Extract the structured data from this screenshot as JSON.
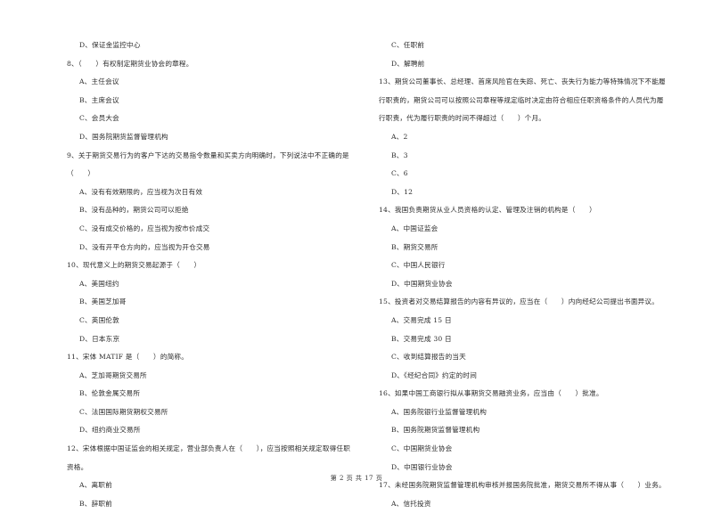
{
  "left_column": [
    {
      "type": "opt",
      "text": "D、保证金监控中心"
    },
    {
      "type": "q",
      "text": "8、（　　）有权制定期货业协会的章程。"
    },
    {
      "type": "opt",
      "text": "A、主任会议"
    },
    {
      "type": "opt",
      "text": "B、主席会议"
    },
    {
      "type": "opt",
      "text": "C、会员大会"
    },
    {
      "type": "opt",
      "text": "D、国务院期货监督管理机构"
    },
    {
      "type": "q",
      "text": "9、关于期货交易行为的客户下达的交易指令数量和买卖方向明确时，下列说法中不正确的是"
    },
    {
      "type": "q",
      "text": "（　　）"
    },
    {
      "type": "opt",
      "text": "A、没有有效期限的，应当视为次日有效"
    },
    {
      "type": "opt",
      "text": "B、没有品种的，期货公司可以拒绝"
    },
    {
      "type": "opt",
      "text": "C、没有成交价格的，应当视为按市价成交"
    },
    {
      "type": "opt",
      "text": "D、没有开平仓方向的，应当视为开仓交易"
    },
    {
      "type": "q",
      "text": "10、现代意义上的期货交易起源于（　　）"
    },
    {
      "type": "opt",
      "text": "A、美国纽约"
    },
    {
      "type": "opt",
      "text": "B、美国芝加哥"
    },
    {
      "type": "opt",
      "text": "C、英国伦敦"
    },
    {
      "type": "opt",
      "text": "D、日本东京"
    },
    {
      "type": "q",
      "text": "11、宋体 MATIF 是（　　）的简称。"
    },
    {
      "type": "opt",
      "text": "A、芝加哥期货交易所"
    },
    {
      "type": "opt",
      "text": "B、伦敦金属交易所"
    },
    {
      "type": "opt",
      "text": "C、法国国际期货期权交易所"
    },
    {
      "type": "opt",
      "text": "D、纽约商业交易所"
    },
    {
      "type": "q",
      "text": "12、宋体根据中国证监会的相关规定，营业部负责人在（　　），应当按照相关规定取得任职"
    },
    {
      "type": "q",
      "text": "资格。"
    },
    {
      "type": "opt",
      "text": "A、离职前"
    },
    {
      "type": "opt",
      "text": "B、辞职前"
    }
  ],
  "right_column": [
    {
      "type": "opt",
      "text": "C、任职前"
    },
    {
      "type": "opt",
      "text": "D、解聘前"
    },
    {
      "type": "q",
      "text": "13、期货公司董事长、总经理、首席风险官在失踪、死亡、丧失行为能力等特殊情况下不能履"
    },
    {
      "type": "q",
      "text": "行职责的，期货公司可以按照公司章程等规定临时决定由符合相应任职资格条件的人员代为履"
    },
    {
      "type": "q",
      "text": "行职责，代为履行职责的时间不得超过（　　）个月。"
    },
    {
      "type": "opt",
      "text": "A、2"
    },
    {
      "type": "opt",
      "text": "B、3"
    },
    {
      "type": "opt",
      "text": "C、6"
    },
    {
      "type": "opt",
      "text": "D、12"
    },
    {
      "type": "q",
      "text": "14、我国负责期货从业人员资格的认定、管理及注销的机构是（　　）"
    },
    {
      "type": "opt",
      "text": "A、中国证监会"
    },
    {
      "type": "opt",
      "text": "B、期货交易所"
    },
    {
      "type": "opt",
      "text": "C、中国人民银行"
    },
    {
      "type": "opt",
      "text": "D、中国期货业协会"
    },
    {
      "type": "q",
      "text": "15、投资者对交易结算报告的内容有异议的，应当在（　　）内向经纪公司提出书面异议。"
    },
    {
      "type": "opt",
      "text": "A、交易完成 15 日"
    },
    {
      "type": "opt",
      "text": "B、交易完成 30 日"
    },
    {
      "type": "opt",
      "text": "C、收到结算报告的当天"
    },
    {
      "type": "opt",
      "text": "D、《经纪合同》约定的时间"
    },
    {
      "type": "q",
      "text": "16、如果中国工商银行拟从事期货交易融资业务，应当由（　　）批准。"
    },
    {
      "type": "opt",
      "text": "A、国务院银行业监督管理机构"
    },
    {
      "type": "opt",
      "text": "B、国务院期货监督管理机构"
    },
    {
      "type": "opt",
      "text": "C、中国期货业协会"
    },
    {
      "type": "opt",
      "text": "D、中国银行业协会"
    },
    {
      "type": "q",
      "text": "17、未经国务院期货监督管理机构审核并报国务院批准，期货交易所不得从事（　　）业务。"
    },
    {
      "type": "opt",
      "text": "A、信托投资"
    }
  ],
  "footer": {
    "page_label": "第 2 页 共 17 页"
  }
}
